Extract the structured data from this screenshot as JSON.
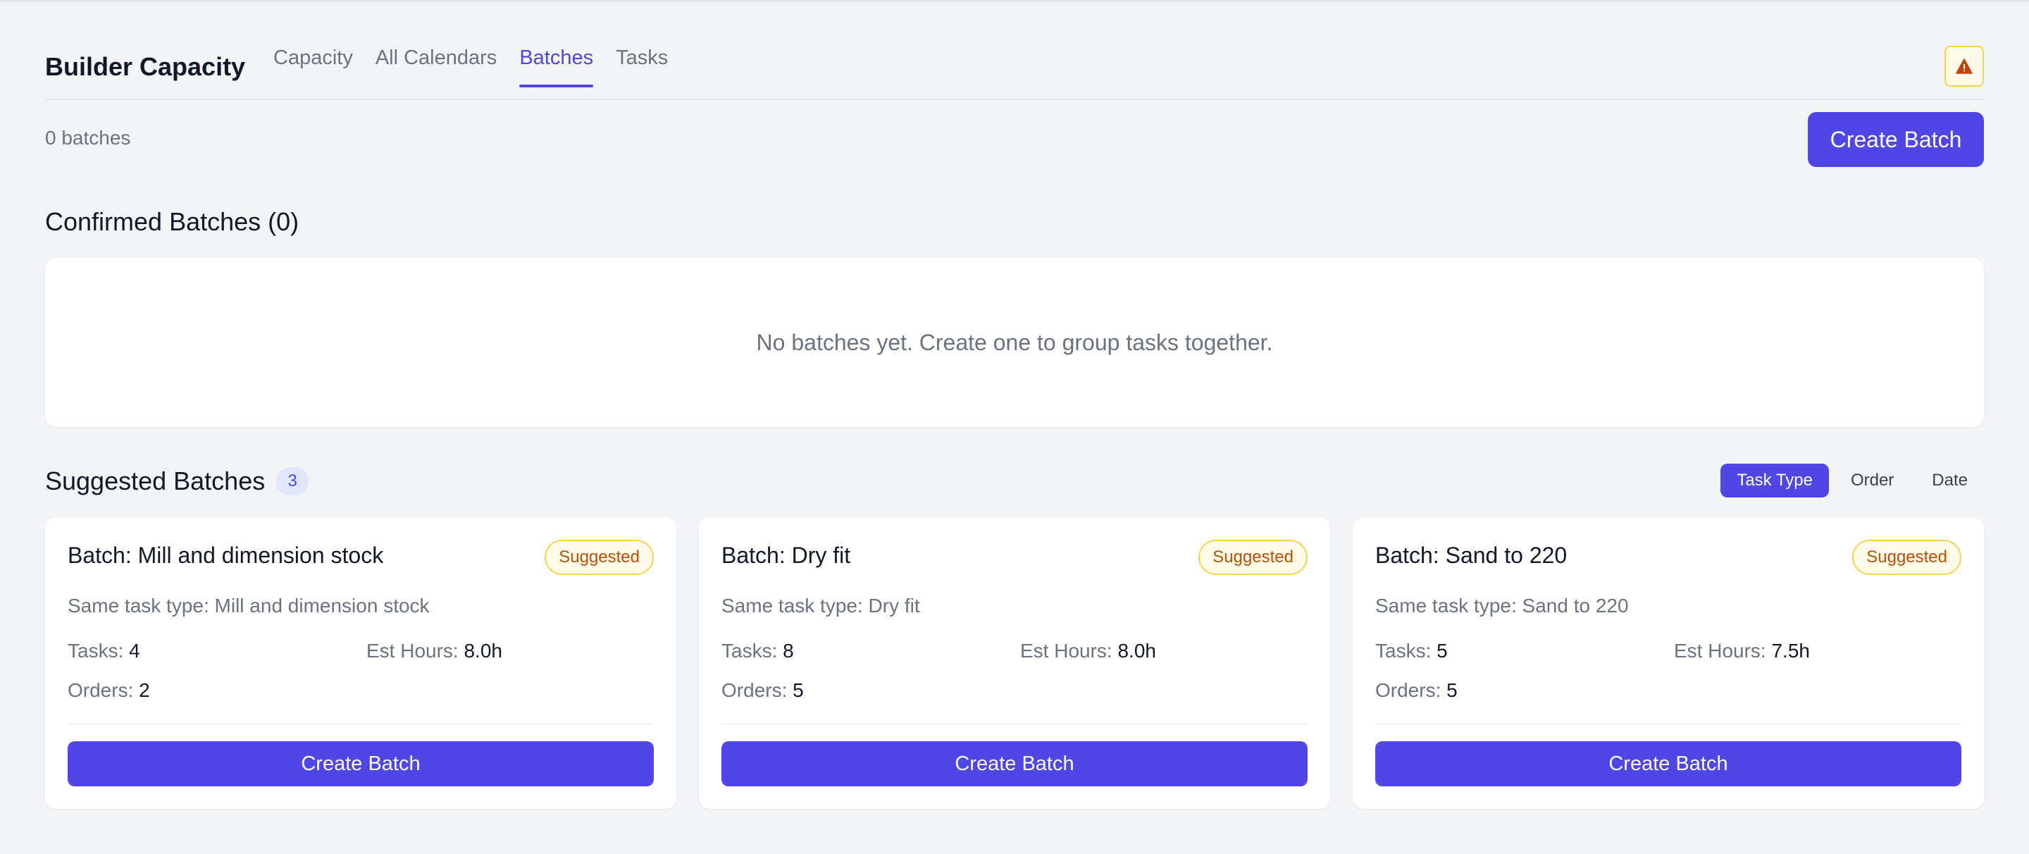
{
  "app": {
    "title": "Builder Capacity",
    "tabs": [
      {
        "label": "Capacity",
        "active": false
      },
      {
        "label": "All Calendars",
        "active": false
      },
      {
        "label": "Batches",
        "active": true
      },
      {
        "label": "Tasks",
        "active": false
      }
    ],
    "alert_icon": "warning-triangle-icon"
  },
  "toolbar": {
    "batch_count": "0 batches",
    "create_label": "Create Batch"
  },
  "confirmed": {
    "title": "Confirmed Batches (0)",
    "empty_text": "No batches yet. Create one to group tasks together."
  },
  "suggested": {
    "title": "Suggested Batches",
    "count": "3",
    "group_by": [
      "Task Type",
      "Order",
      "Date"
    ],
    "group_by_selected": "Task Type",
    "cards": [
      {
        "title": "Batch: Mill and dimension stock",
        "status": "Suggested",
        "description": "Same task type: Mill and dimension stock",
        "tasks_label": "Tasks:",
        "tasks": "4",
        "hours_label": "Est Hours:",
        "hours": "8.0h",
        "orders_label": "Orders:",
        "orders": "2",
        "button": "Create Batch"
      },
      {
        "title": "Batch: Dry fit",
        "status": "Suggested",
        "description": "Same task type: Dry fit",
        "tasks_label": "Tasks:",
        "tasks": "8",
        "hours_label": "Est Hours:",
        "hours": "8.0h",
        "orders_label": "Orders:",
        "orders": "5",
        "button": "Create Batch"
      },
      {
        "title": "Batch: Sand to 220",
        "status": "Suggested",
        "description": "Same task type: Sand to 220",
        "tasks_label": "Tasks:",
        "tasks": "5",
        "hours_label": "Est Hours:",
        "hours": "7.5h",
        "orders_label": "Orders:",
        "orders": "5",
        "button": "Create Batch"
      }
    ]
  },
  "colors": {
    "accent": "#4f46e5",
    "badge_bg": "#e0e7ff",
    "warning_border": "#fcd34d",
    "warning_text": "#b45309",
    "background": "#f3f4f6"
  }
}
